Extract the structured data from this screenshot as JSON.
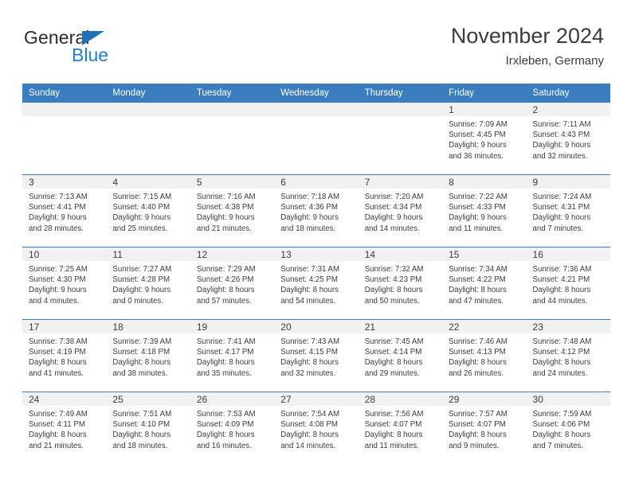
{
  "brand": {
    "name_part1": "General",
    "name_part2": "Blue",
    "triangle_color": "#1f6fba",
    "blue_color": "#1f7fd4"
  },
  "header": {
    "title": "November 2024",
    "location": "Irxleben, Germany"
  },
  "theme": {
    "header_blue": "#3a7ebf",
    "daynum_band": "#f1f1f1",
    "text": "#3c3c3c"
  },
  "weekdays": [
    "Sunday",
    "Monday",
    "Tuesday",
    "Wednesday",
    "Thursday",
    "Friday",
    "Saturday"
  ],
  "labels": {
    "sunrise": "Sunrise:",
    "sunset": "Sunset:",
    "daylight": "Daylight:"
  },
  "weeks": [
    [
      {
        "day": "",
        "line1": "",
        "line2": "",
        "line3": "",
        "line4": ""
      },
      {
        "day": "",
        "line1": "",
        "line2": "",
        "line3": "",
        "line4": ""
      },
      {
        "day": "",
        "line1": "",
        "line2": "",
        "line3": "",
        "line4": ""
      },
      {
        "day": "",
        "line1": "",
        "line2": "",
        "line3": "",
        "line4": ""
      },
      {
        "day": "",
        "line1": "",
        "line2": "",
        "line3": "",
        "line4": ""
      },
      {
        "day": "1",
        "line1": "Sunrise: 7:09 AM",
        "line2": "Sunset: 4:45 PM",
        "line3": "Daylight: 9 hours",
        "line4": "and 36 minutes."
      },
      {
        "day": "2",
        "line1": "Sunrise: 7:11 AM",
        "line2": "Sunset: 4:43 PM",
        "line3": "Daylight: 9 hours",
        "line4": "and 32 minutes."
      }
    ],
    [
      {
        "day": "3",
        "line1": "Sunrise: 7:13 AM",
        "line2": "Sunset: 4:41 PM",
        "line3": "Daylight: 9 hours",
        "line4": "and 28 minutes."
      },
      {
        "day": "4",
        "line1": "Sunrise: 7:15 AM",
        "line2": "Sunset: 4:40 PM",
        "line3": "Daylight: 9 hours",
        "line4": "and 25 minutes."
      },
      {
        "day": "5",
        "line1": "Sunrise: 7:16 AM",
        "line2": "Sunset: 4:38 PM",
        "line3": "Daylight: 9 hours",
        "line4": "and 21 minutes."
      },
      {
        "day": "6",
        "line1": "Sunrise: 7:18 AM",
        "line2": "Sunset: 4:36 PM",
        "line3": "Daylight: 9 hours",
        "line4": "and 18 minutes."
      },
      {
        "day": "7",
        "line1": "Sunrise: 7:20 AM",
        "line2": "Sunset: 4:34 PM",
        "line3": "Daylight: 9 hours",
        "line4": "and 14 minutes."
      },
      {
        "day": "8",
        "line1": "Sunrise: 7:22 AM",
        "line2": "Sunset: 4:33 PM",
        "line3": "Daylight: 9 hours",
        "line4": "and 11 minutes."
      },
      {
        "day": "9",
        "line1": "Sunrise: 7:24 AM",
        "line2": "Sunset: 4:31 PM",
        "line3": "Daylight: 9 hours",
        "line4": "and 7 minutes."
      }
    ],
    [
      {
        "day": "10",
        "line1": "Sunrise: 7:25 AM",
        "line2": "Sunset: 4:30 PM",
        "line3": "Daylight: 9 hours",
        "line4": "and 4 minutes."
      },
      {
        "day": "11",
        "line1": "Sunrise: 7:27 AM",
        "line2": "Sunset: 4:28 PM",
        "line3": "Daylight: 9 hours",
        "line4": "and 0 minutes."
      },
      {
        "day": "12",
        "line1": "Sunrise: 7:29 AM",
        "line2": "Sunset: 4:26 PM",
        "line3": "Daylight: 8 hours",
        "line4": "and 57 minutes."
      },
      {
        "day": "13",
        "line1": "Sunrise: 7:31 AM",
        "line2": "Sunset: 4:25 PM",
        "line3": "Daylight: 8 hours",
        "line4": "and 54 minutes."
      },
      {
        "day": "14",
        "line1": "Sunrise: 7:32 AM",
        "line2": "Sunset: 4:23 PM",
        "line3": "Daylight: 8 hours",
        "line4": "and 50 minutes."
      },
      {
        "day": "15",
        "line1": "Sunrise: 7:34 AM",
        "line2": "Sunset: 4:22 PM",
        "line3": "Daylight: 8 hours",
        "line4": "and 47 minutes."
      },
      {
        "day": "16",
        "line1": "Sunrise: 7:36 AM",
        "line2": "Sunset: 4:21 PM",
        "line3": "Daylight: 8 hours",
        "line4": "and 44 minutes."
      }
    ],
    [
      {
        "day": "17",
        "line1": "Sunrise: 7:38 AM",
        "line2": "Sunset: 4:19 PM",
        "line3": "Daylight: 8 hours",
        "line4": "and 41 minutes."
      },
      {
        "day": "18",
        "line1": "Sunrise: 7:39 AM",
        "line2": "Sunset: 4:18 PM",
        "line3": "Daylight: 8 hours",
        "line4": "and 38 minutes."
      },
      {
        "day": "19",
        "line1": "Sunrise: 7:41 AM",
        "line2": "Sunset: 4:17 PM",
        "line3": "Daylight: 8 hours",
        "line4": "and 35 minutes."
      },
      {
        "day": "20",
        "line1": "Sunrise: 7:43 AM",
        "line2": "Sunset: 4:15 PM",
        "line3": "Daylight: 8 hours",
        "line4": "and 32 minutes."
      },
      {
        "day": "21",
        "line1": "Sunrise: 7:45 AM",
        "line2": "Sunset: 4:14 PM",
        "line3": "Daylight: 8 hours",
        "line4": "and 29 minutes."
      },
      {
        "day": "22",
        "line1": "Sunrise: 7:46 AM",
        "line2": "Sunset: 4:13 PM",
        "line3": "Daylight: 8 hours",
        "line4": "and 26 minutes."
      },
      {
        "day": "23",
        "line1": "Sunrise: 7:48 AM",
        "line2": "Sunset: 4:12 PM",
        "line3": "Daylight: 8 hours",
        "line4": "and 24 minutes."
      }
    ],
    [
      {
        "day": "24",
        "line1": "Sunrise: 7:49 AM",
        "line2": "Sunset: 4:11 PM",
        "line3": "Daylight: 8 hours",
        "line4": "and 21 minutes."
      },
      {
        "day": "25",
        "line1": "Sunrise: 7:51 AM",
        "line2": "Sunset: 4:10 PM",
        "line3": "Daylight: 8 hours",
        "line4": "and 18 minutes."
      },
      {
        "day": "26",
        "line1": "Sunrise: 7:53 AM",
        "line2": "Sunset: 4:09 PM",
        "line3": "Daylight: 8 hours",
        "line4": "and 16 minutes."
      },
      {
        "day": "27",
        "line1": "Sunrise: 7:54 AM",
        "line2": "Sunset: 4:08 PM",
        "line3": "Daylight: 8 hours",
        "line4": "and 14 minutes."
      },
      {
        "day": "28",
        "line1": "Sunrise: 7:56 AM",
        "line2": "Sunset: 4:07 PM",
        "line3": "Daylight: 8 hours",
        "line4": "and 11 minutes."
      },
      {
        "day": "29",
        "line1": "Sunrise: 7:57 AM",
        "line2": "Sunset: 4:07 PM",
        "line3": "Daylight: 8 hours",
        "line4": "and 9 minutes."
      },
      {
        "day": "30",
        "line1": "Sunrise: 7:59 AM",
        "line2": "Sunset: 4:06 PM",
        "line3": "Daylight: 8 hours",
        "line4": "and 7 minutes."
      }
    ]
  ]
}
